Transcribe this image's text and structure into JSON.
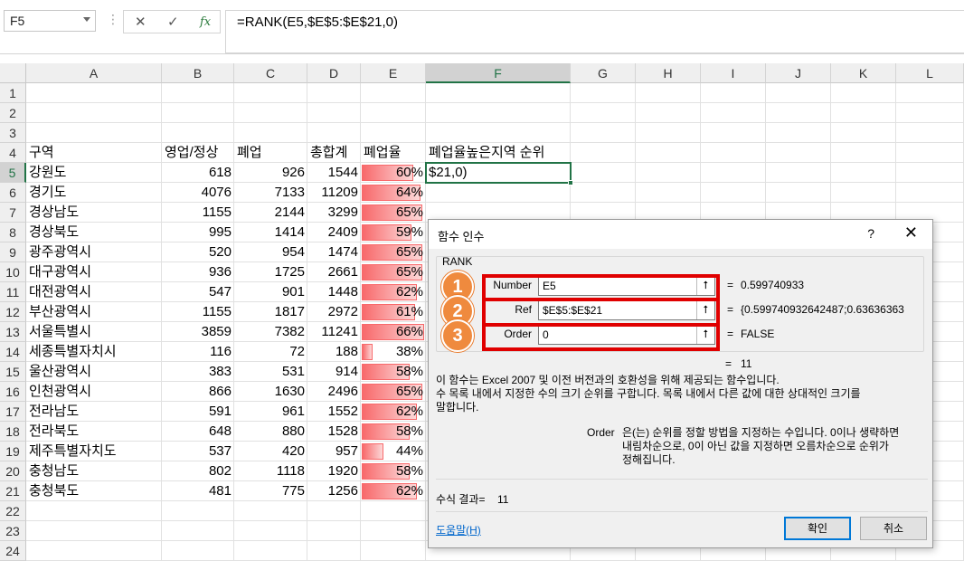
{
  "formula_bar": {
    "name_box": "F5",
    "dots": "⋮",
    "cancel_glyph": "✕",
    "enter_glyph": "✓",
    "fx_glyph": "fx",
    "formula": "=RANK(E5,$E$5:$E$21,0)"
  },
  "columns": [
    "A",
    "B",
    "C",
    "D",
    "E",
    "F",
    "G",
    "H",
    "I",
    "J",
    "K",
    "L"
  ],
  "rows": [
    "1",
    "2",
    "3",
    "4",
    "5",
    "6",
    "7",
    "8",
    "9",
    "10",
    "11",
    "12",
    "13",
    "14",
    "15",
    "16",
    "17",
    "18",
    "19",
    "20",
    "21",
    "22",
    "23",
    "24"
  ],
  "headers": {
    "a": "구역",
    "b": "영업/정상",
    "c": "폐업",
    "d": "총합계",
    "e": "폐업율",
    "f": "폐업율높은지역 순위"
  },
  "table": [
    {
      "region": "강원도",
      "open": "618",
      "closed": "926",
      "total": "1544",
      "rate": "60%",
      "rate_value": 0.6
    },
    {
      "region": "경기도",
      "open": "4076",
      "closed": "7133",
      "total": "11209",
      "rate": "64%",
      "rate_value": 0.64
    },
    {
      "region": "경상남도",
      "open": "1155",
      "closed": "2144",
      "total": "3299",
      "rate": "65%",
      "rate_value": 0.65
    },
    {
      "region": "경상북도",
      "open": "995",
      "closed": "1414",
      "total": "2409",
      "rate": "59%",
      "rate_value": 0.59
    },
    {
      "region": "광주광역시",
      "open": "520",
      "closed": "954",
      "total": "1474",
      "rate": "65%",
      "rate_value": 0.65
    },
    {
      "region": "대구광역시",
      "open": "936",
      "closed": "1725",
      "total": "2661",
      "rate": "65%",
      "rate_value": 0.65
    },
    {
      "region": "대전광역시",
      "open": "547",
      "closed": "901",
      "total": "1448",
      "rate": "62%",
      "rate_value": 0.62
    },
    {
      "region": "부산광역시",
      "open": "1155",
      "closed": "1817",
      "total": "2972",
      "rate": "61%",
      "rate_value": 0.61
    },
    {
      "region": "서울특별시",
      "open": "3859",
      "closed": "7382",
      "total": "11241",
      "rate": "66%",
      "rate_value": 0.66
    },
    {
      "region": "세종특별자치시",
      "open": "116",
      "closed": "72",
      "total": "188",
      "rate": "38%",
      "rate_value": 0.38
    },
    {
      "region": "울산광역시",
      "open": "383",
      "closed": "531",
      "total": "914",
      "rate": "58%",
      "rate_value": 0.58
    },
    {
      "region": "인천광역시",
      "open": "866",
      "closed": "1630",
      "total": "2496",
      "rate": "65%",
      "rate_value": 0.65
    },
    {
      "region": "전라남도",
      "open": "591",
      "closed": "961",
      "total": "1552",
      "rate": "62%",
      "rate_value": 0.62
    },
    {
      "region": "전라북도",
      "open": "648",
      "closed": "880",
      "total": "1528",
      "rate": "58%",
      "rate_value": 0.58
    },
    {
      "region": "제주특별자치도",
      "open": "537",
      "closed": "420",
      "total": "957",
      "rate": "44%",
      "rate_value": 0.44
    },
    {
      "region": "충청남도",
      "open": "802",
      "closed": "1118",
      "total": "1920",
      "rate": "58%",
      "rate_value": 0.58
    },
    {
      "region": "충청북도",
      "open": "481",
      "closed": "775",
      "total": "1256",
      "rate": "62%",
      "rate_value": 0.62
    }
  ],
  "active_cell_text": "$21,0)",
  "dialog": {
    "title": "함수 인수",
    "help_glyph": "?",
    "close_glyph": "✕",
    "function_name": "RANK",
    "args": [
      {
        "badge": "1",
        "label": "Number",
        "value": "E5",
        "result": "0.599740933"
      },
      {
        "badge": "2",
        "label": "Ref",
        "value": "$E$5:$E$21",
        "result": "{0.599740932642487;0.63636363"
      },
      {
        "badge": "3",
        "label": "Order",
        "value": "0",
        "result": "FALSE"
      }
    ],
    "collapse_glyph": "⭡",
    "eq_glyph": "=",
    "total_result": "11",
    "description_line1": "이 함수는 Excel 2007 및 이전 버전과의 호환성을 위해 제공되는 함수입니다.",
    "description_line2": "수 목록 내에서 지정한 수의 크기 순위를 구합니다. 목록 내에서 다른 값에 대한 상대적인 크기를",
    "description_line3": "말합니다.",
    "arg_help_name": "Order",
    "arg_help_line1": "은(는) 순위를 정할 방법을 지정하는 수입니다. 0이나 생략하면",
    "arg_help_line2": "내림차순으로, 0이 아닌 값을 지정하면 오름차순으로 순위가",
    "arg_help_line3": "정해집니다.",
    "formula_result_label": "수식 결과=",
    "formula_result_value": "11",
    "help_link": "도움말(H)",
    "ok_label": "확인",
    "cancel_label": "취소"
  },
  "colors": {
    "accent": "#217346",
    "highlight": "#e00000",
    "badge": "#ef8a3e",
    "databar": "#f8696b"
  }
}
